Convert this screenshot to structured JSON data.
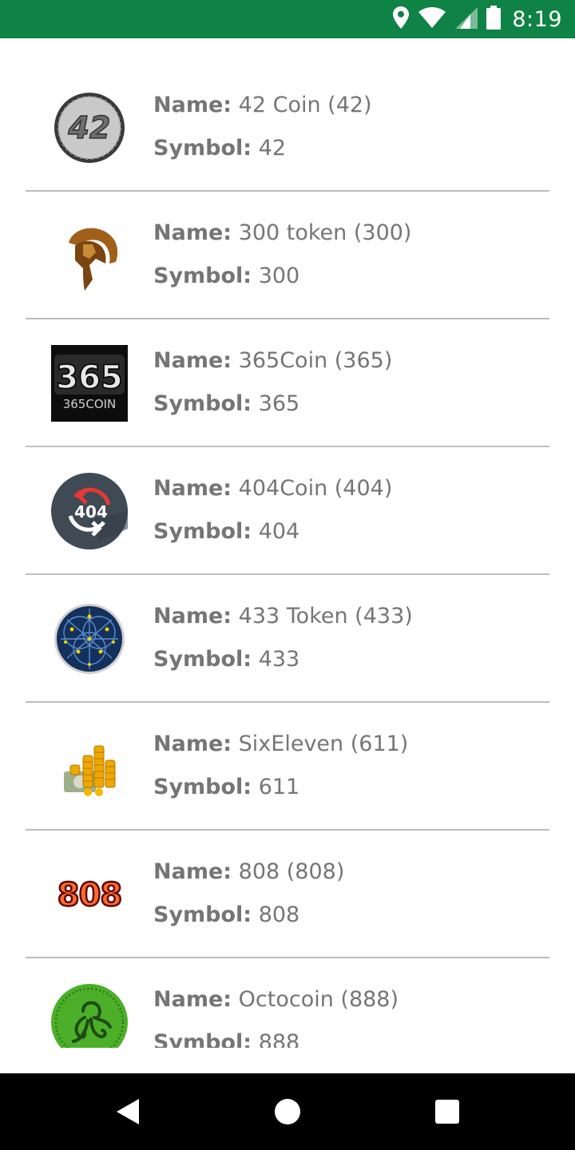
{
  "status_bar": {
    "time": "8:19",
    "icons": [
      "location-icon",
      "wifi-icon",
      "signal-icon",
      "battery-icon"
    ],
    "color": "#0f8246"
  },
  "labels": {
    "name": "Name:",
    "symbol": "Symbol:"
  },
  "coins": [
    {
      "name": "42 Coin (42)",
      "symbol": "42",
      "logo": "42"
    },
    {
      "name": "300 token (300)",
      "symbol": "300",
      "logo": "spartan-helmet"
    },
    {
      "name": "365Coin (365)",
      "symbol": "365",
      "logo": "365",
      "logo_text": "365COIN"
    },
    {
      "name": "404Coin (404)",
      "symbol": "404",
      "logo": "404"
    },
    {
      "name": "433 Token (433)",
      "symbol": "433",
      "logo": "star-network"
    },
    {
      "name": "SixEleven (611)",
      "symbol": "611",
      "logo": "gold-coins"
    },
    {
      "name": "808 (808)",
      "symbol": "808",
      "logo": "808"
    },
    {
      "name": "Octocoin (888)",
      "symbol": "888",
      "logo": "octopus"
    }
  ],
  "nav_bar": {
    "buttons": [
      "back-icon",
      "home-icon",
      "recents-icon"
    ]
  }
}
